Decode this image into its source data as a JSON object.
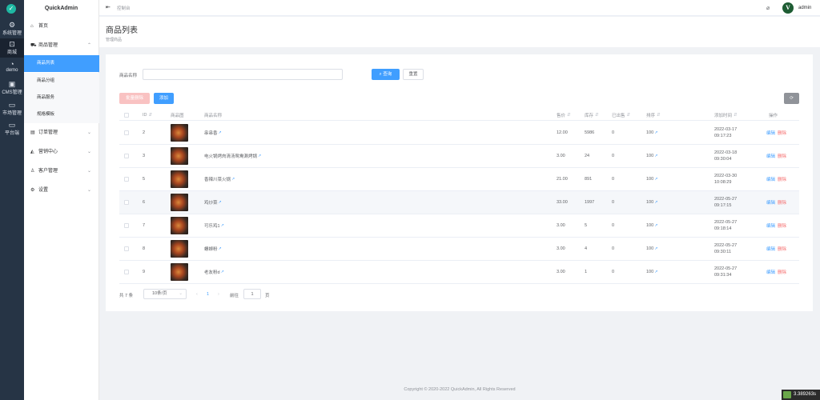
{
  "rail": [
    {
      "label": "系统管理",
      "icon": "gear-icon",
      "glyph": "⚙"
    },
    {
      "label": "商城",
      "icon": "bag-icon",
      "glyph": "👜"
    },
    {
      "label": "demo",
      "icon": "apple-icon",
      "glyph": "◔"
    },
    {
      "label": "CMS管理",
      "icon": "box-icon",
      "glyph": "▣"
    },
    {
      "label": "市场管理",
      "icon": "monitor-icon",
      "glyph": "▭"
    },
    {
      "label": "平台端",
      "icon": "monitor-icon",
      "glyph": "▭"
    }
  ],
  "sidebar": {
    "brand": "QuickAdmin",
    "home": "首页",
    "goods": "商品管理",
    "goods_sub": [
      "商品列表",
      "商品分组",
      "商品服务",
      "规格模板"
    ],
    "orders": "订单管理",
    "marketing": "营销中心",
    "customers": "客户管理",
    "settings": "设置"
  },
  "topbar": {
    "breadcrumb": "控制台",
    "username": "admin",
    "avatar_letter": "V"
  },
  "page": {
    "title": "商品列表",
    "subtitle": "管理商品"
  },
  "search": {
    "label": "商品名称",
    "value": "",
    "query_button": "查询",
    "reset_button": "重置"
  },
  "toolbar": {
    "batch_delete": "批量删除",
    "add": "添加",
    "refresh": "⟳"
  },
  "table": {
    "headers": {
      "id": "ID",
      "image": "商品图",
      "name": "商品名称",
      "price": "售价",
      "stock": "库存",
      "sold": "已出售",
      "sort": "排序",
      "created": "添加时间",
      "actions": "操作"
    },
    "edit_label": "编辑",
    "delete_label": "删除",
    "rows": [
      {
        "id": "2",
        "name": "串串香",
        "price": "12.00",
        "stock": "5986",
        "sold": "0",
        "sort": "100",
        "date": "2022-03-17",
        "time": "09:17:23"
      },
      {
        "id": "3",
        "name": "电火锅烤肉清汤鸳鸯涮烤锅",
        "price": "3.00",
        "stock": "24",
        "sold": "0",
        "sort": "100",
        "date": "2022-03-18",
        "time": "09:30:04"
      },
      {
        "id": "5",
        "name": "香辣川菜火锅",
        "price": "21.00",
        "stock": "891",
        "sold": "0",
        "sort": "100",
        "date": "2022-03-30",
        "time": "10:08:29"
      },
      {
        "id": "6",
        "name": "鸡炒菜",
        "price": "33.00",
        "stock": "1997",
        "sold": "0",
        "sort": "100",
        "date": "2022-05-27",
        "time": "09:17:15"
      },
      {
        "id": "7",
        "name": "可乐鸡1",
        "price": "3.00",
        "stock": "5",
        "sold": "0",
        "sort": "100",
        "date": "2022-05-27",
        "time": "09:18:14"
      },
      {
        "id": "8",
        "name": "螺蛳粉",
        "price": "3.00",
        "stock": "4",
        "sold": "0",
        "sort": "100",
        "date": "2022-05-27",
        "time": "09:30:11"
      },
      {
        "id": "9",
        "name": "老友粉d",
        "price": "3.00",
        "stock": "1",
        "sold": "0",
        "sort": "100",
        "date": "2022-05-27",
        "time": "09:31:34"
      }
    ]
  },
  "pagination": {
    "total": "共 7 条",
    "page_size": "10条/页",
    "current_page": "1",
    "goto_label": "前往",
    "goto_value": "1",
    "page_unit": "页"
  },
  "footer": "Copyright © 2020-2022 QuickAdmin, All Rights Reserved",
  "timer": "3.389263s"
}
